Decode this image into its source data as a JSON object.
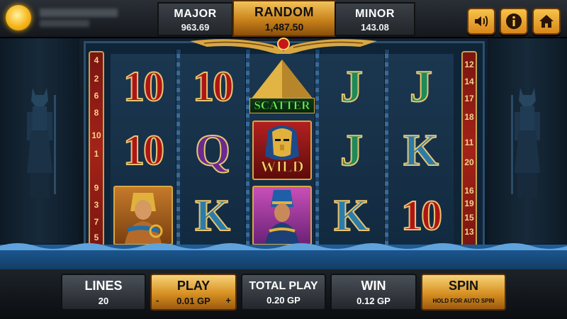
{
  "jackpots": {
    "major": {
      "label": "MAJOR",
      "value": "963.69"
    },
    "random": {
      "label": "RANDOM",
      "value": "1,487.50"
    },
    "minor": {
      "label": "MINOR",
      "value": "143.08"
    }
  },
  "top_buttons": [
    "speaker-icon",
    "info-icon",
    "home-icon"
  ],
  "paylines": {
    "left": [
      "4",
      "2",
      "6",
      "8",
      "10",
      "1",
      "9",
      "3",
      "7",
      "5"
    ],
    "right": [
      "12",
      "14",
      "17",
      "18",
      "11",
      "20",
      "16",
      "19",
      "15",
      "13"
    ]
  },
  "reels": [
    [
      {
        "type": "ten",
        "text": "10"
      },
      {
        "type": "ten",
        "text": "10"
      },
      {
        "type": "pharaoh",
        "text": ""
      }
    ],
    [
      {
        "type": "ten",
        "text": "10"
      },
      {
        "type": "q",
        "text": "Q"
      },
      {
        "type": "k",
        "text": "K"
      }
    ],
    [
      {
        "type": "scatter",
        "text": "SCATTER"
      },
      {
        "type": "wild",
        "text": "WILD"
      },
      {
        "type": "queen",
        "text": ""
      }
    ],
    [
      {
        "type": "j",
        "text": "J"
      },
      {
        "type": "j",
        "text": "J"
      },
      {
        "type": "k",
        "text": "K"
      }
    ],
    [
      {
        "type": "j",
        "text": "J"
      },
      {
        "type": "k",
        "text": "K"
      },
      {
        "type": "ten",
        "text": "10"
      }
    ]
  ],
  "bottom": {
    "lines": {
      "label": "LINES",
      "value": "20"
    },
    "play": {
      "label": "PLAY",
      "value": "0.01 GP",
      "minus": "-",
      "plus": "+"
    },
    "total_play": {
      "label": "TOTAL PLAY",
      "value": "0.20 GP"
    },
    "win": {
      "label": "WIN",
      "value": "0.12 GP"
    },
    "spin": {
      "label": "SPIN",
      "sub": "HOLD FOR AUTO SPIN"
    }
  },
  "colors": {
    "gold": "#d9a742",
    "accent": "#f6b51a"
  }
}
